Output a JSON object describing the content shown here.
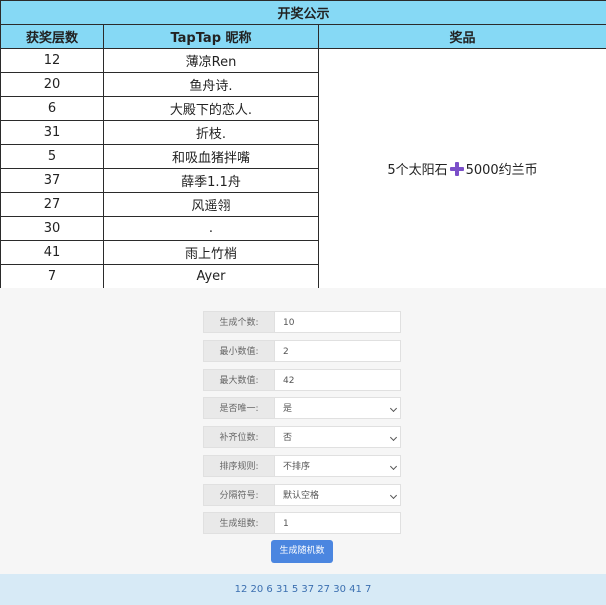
{
  "table": {
    "title": "开奖公示",
    "headers": [
      "获奖层数",
      "TapTap 昵称",
      "奖品"
    ],
    "rows": [
      {
        "floor": "12",
        "nickname": "薄凉Ren"
      },
      {
        "floor": "20",
        "nickname": "鱼舟诗."
      },
      {
        "floor": "6",
        "nickname": "大殿下的恋人."
      },
      {
        "floor": "31",
        "nickname": "折枝."
      },
      {
        "floor": "5",
        "nickname": "和吸血猪拌嘴"
      },
      {
        "floor": "37",
        "nickname": "薛季1.1舟"
      },
      {
        "floor": "27",
        "nickname": "风遥翎"
      },
      {
        "floor": "30",
        "nickname": "."
      },
      {
        "floor": "41",
        "nickname": "雨上竹梢"
      },
      {
        "floor": "7",
        "nickname": "Ayer"
      }
    ],
    "prize_part1": "5个太阳石",
    "prize_part2": "5000约兰币",
    "plus_color": "#7b4fc9"
  },
  "generator": {
    "fields": [
      {
        "label": "生成个数:",
        "value": "10",
        "type": "input"
      },
      {
        "label": "最小数值:",
        "value": "2",
        "type": "input"
      },
      {
        "label": "最大数值:",
        "value": "42",
        "type": "input"
      },
      {
        "label": "是否唯一:",
        "value": "是",
        "type": "select"
      },
      {
        "label": "补齐位数:",
        "value": "否",
        "type": "select"
      },
      {
        "label": "排序规则:",
        "value": "不排序",
        "type": "select"
      },
      {
        "label": "分隔符号:",
        "value": "默认空格",
        "type": "select"
      },
      {
        "label": "生成组数:",
        "value": "1",
        "type": "input"
      }
    ],
    "button_label": "生成随机数",
    "result": "12 20 6 31 5 37 27 30 41 7"
  },
  "colors": {
    "header_bg": "#86d9f5",
    "button_bg": "#4b86e0",
    "result_bg": "#d7eaf6"
  }
}
